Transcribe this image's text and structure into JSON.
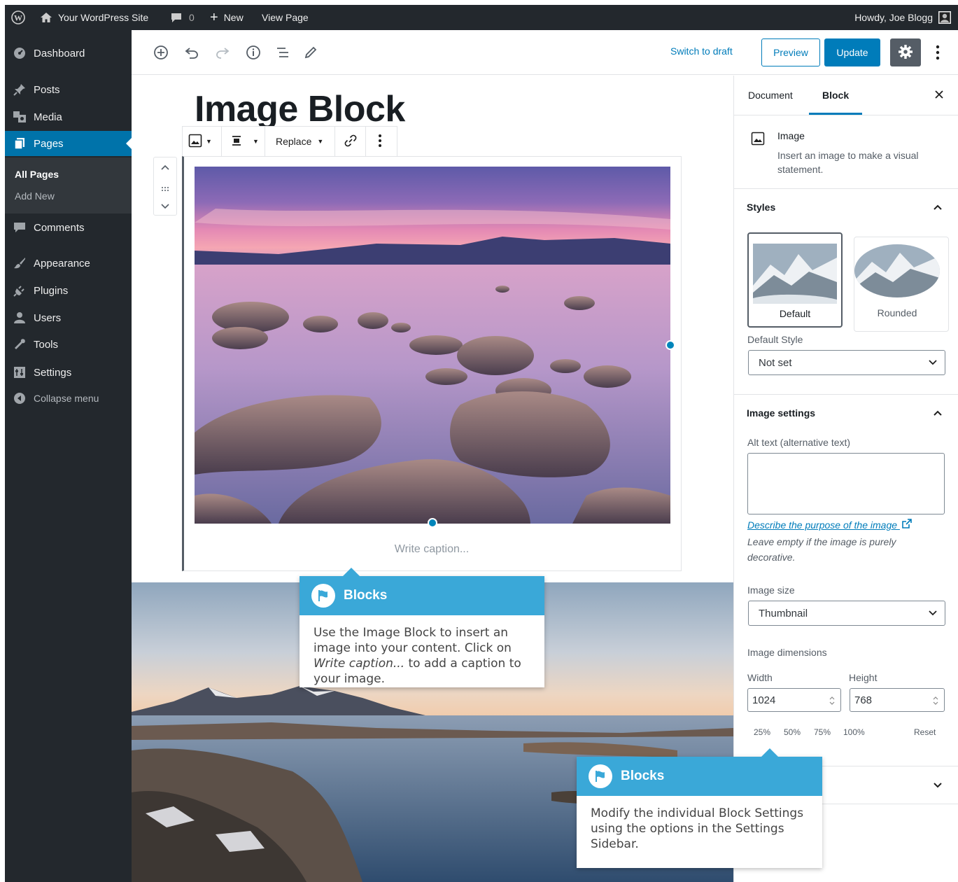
{
  "admin_bar": {
    "site_name": "Your WordPress Site",
    "comments_count": "0",
    "new_label": "New",
    "view_page": "View Page",
    "howdy": "Howdy, Joe Blogg"
  },
  "sidebar": {
    "items": [
      {
        "label": "Dashboard",
        "icon": "dashboard-icon"
      },
      {
        "label": "Posts",
        "icon": "pin-icon"
      },
      {
        "label": "Media",
        "icon": "media-icon"
      },
      {
        "label": "Pages",
        "icon": "pages-icon"
      },
      {
        "label": "Comments",
        "icon": "comment-icon"
      },
      {
        "label": "Appearance",
        "icon": "brush-icon"
      },
      {
        "label": "Plugins",
        "icon": "plug-icon"
      },
      {
        "label": "Users",
        "icon": "user-icon"
      },
      {
        "label": "Tools",
        "icon": "wrench-icon"
      },
      {
        "label": "Settings",
        "icon": "settings-icon"
      },
      {
        "label": "Collapse menu",
        "icon": "collapse-icon"
      }
    ],
    "submenu": [
      "All Pages",
      "Add New"
    ]
  },
  "header": {
    "switch_draft": "Switch to draft",
    "preview": "Preview",
    "update": "Update"
  },
  "editor": {
    "title": "Image Block",
    "toolbar_replace": "Replace",
    "caption_placeholder": "Write caption..."
  },
  "settings": {
    "tab_document": "Document",
    "tab_block": "Block",
    "block_name": "Image",
    "block_desc": "Insert an image to make a visual statement.",
    "styles_title": "Styles",
    "style_default": "Default",
    "style_rounded": "Rounded",
    "default_style_label": "Default Style",
    "default_style_value": "Not set",
    "image_settings_title": "Image settings",
    "alt_label": "Alt text (alternative text)",
    "alt_value": "",
    "describe_link": "Describe the purpose of the image",
    "alt_help": "Leave empty if the image is purely decorative.",
    "size_label": "Image size",
    "size_value": "Thumbnail",
    "dimensions_label": "Image dimensions",
    "width_label": "Width",
    "height_label": "Height",
    "width_value": "1024",
    "height_value": "768",
    "pct": [
      "25%",
      "50%",
      "75%",
      "100%"
    ],
    "reset": "Reset"
  },
  "callouts": [
    {
      "title": "Blocks",
      "body_pre": "Use the Image Block to insert an image into your content. Click on ",
      "body_em": "Write caption...",
      "body_post": " to add a caption to your image."
    },
    {
      "title": "Blocks",
      "body": "Modify the individual Block Settings using the options in the Settings Sidebar."
    }
  ],
  "colors": {
    "admin_dark": "#23282d",
    "wp_blue": "#0073aa",
    "button_blue": "#007cba",
    "callout_blue": "#3aa8d8"
  }
}
